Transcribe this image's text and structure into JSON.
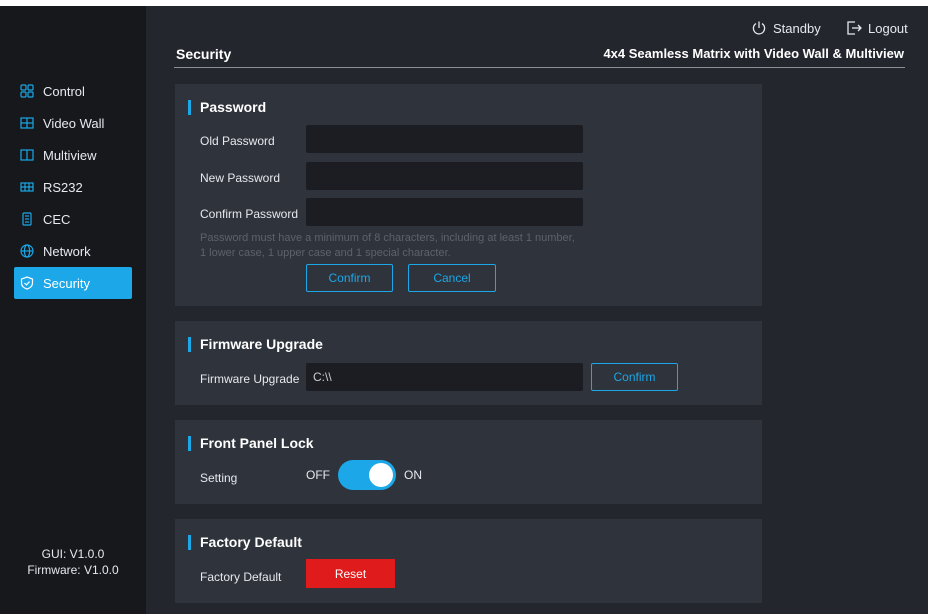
{
  "sidebar": {
    "items": [
      {
        "label": "Control",
        "icon": "grid-icon"
      },
      {
        "label": "Video Wall",
        "icon": "video-wall-icon"
      },
      {
        "label": "Multiview",
        "icon": "multiview-icon"
      },
      {
        "label": "RS232",
        "icon": "rs232-icon"
      },
      {
        "label": "CEC",
        "icon": "cec-icon"
      },
      {
        "label": "Network",
        "icon": "globe-icon"
      },
      {
        "label": "Security",
        "icon": "shield-icon"
      }
    ],
    "active": "Security",
    "gui_version": "GUI: V1.0.0",
    "firmware_version": "Firmware: V1.0.0"
  },
  "header": {
    "standby_label": "Standby",
    "logout_label": "Logout",
    "page_title": "Security",
    "device_name": "4x4 Seamless Matrix with Video Wall & Multiview"
  },
  "password": {
    "title": "Password",
    "old_label": "Old Password",
    "new_label": "New Password",
    "confirm_label": "Confirm Password",
    "old_value": "",
    "new_value": "",
    "confirm_value": "",
    "hint_line1": "Password must have a minimum of 8 characters, including at least 1 number,",
    "hint_line2": "1 lower case, 1 upper case and 1 special character.",
    "confirm_button": "Confirm",
    "cancel_button": "Cancel"
  },
  "firmware": {
    "title": "Firmware Upgrade",
    "label": "Firmware Upgrade",
    "path_value": "C:\\\\",
    "confirm_button": "Confirm"
  },
  "front_panel": {
    "title": "Front Panel Lock",
    "setting_label": "Setting",
    "off_label": "OFF",
    "on_label": "ON",
    "state": "ON"
  },
  "factory": {
    "title": "Factory Default",
    "label": "Factory Default",
    "reset_button": "Reset"
  },
  "colors": {
    "accent": "#1ba7e8",
    "danger": "#e01b1b",
    "background": "#23262d",
    "sidebar": "#16181c",
    "card": "#2f333b"
  }
}
